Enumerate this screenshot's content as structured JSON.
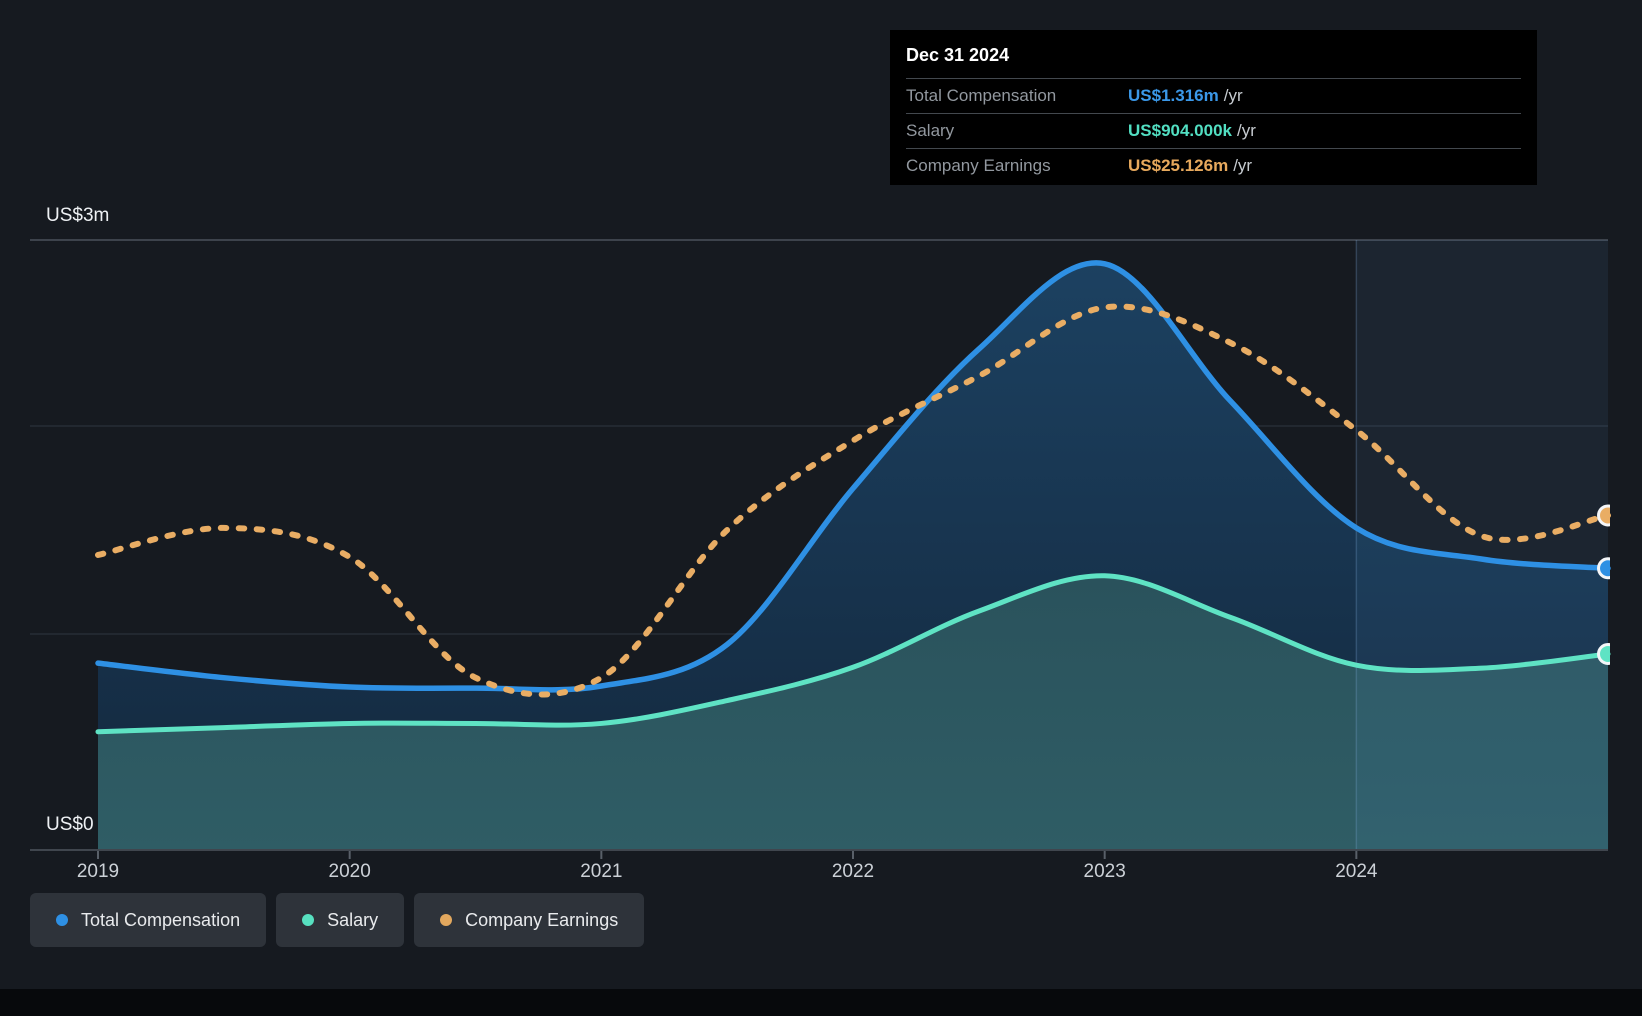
{
  "tooltip": {
    "title": "Dec 31 2024",
    "rows": [
      {
        "label": "Total Compensation",
        "value": "US$1.316m",
        "suffix": "/yr",
        "color": "#3b98e8"
      },
      {
        "label": "Salary",
        "value": "US$904.000k",
        "suffix": "/yr",
        "color": "#52dfc2"
      },
      {
        "label": "Company Earnings",
        "value": "US$25.126m",
        "suffix": "/yr",
        "color": "#e7a95d"
      }
    ]
  },
  "y_axis": {
    "top_label": "US$3m",
    "bottom_label": "US$0"
  },
  "x_axis": {
    "years": [
      "2019",
      "2020",
      "2021",
      "2022",
      "2023",
      "2024"
    ]
  },
  "legend": [
    {
      "label": "Total Compensation",
      "color": "#2e90e4"
    },
    {
      "label": "Salary",
      "color": "#57e0c0"
    },
    {
      "label": "Company Earnings",
      "color": "#e2a85e"
    }
  ],
  "chart_data": {
    "type": "area",
    "title": "CEO compensation over time",
    "x": [
      2019,
      2019.5,
      2020,
      2020.5,
      2021,
      2021.5,
      2022,
      2022.5,
      2023,
      2023.5,
      2024,
      2024.5,
      2025
    ],
    "x_tick_years": [
      2019,
      2020,
      2021,
      2022,
      2023,
      2024
    ],
    "ylim": [
      0,
      3
    ],
    "y_unit": "US$m",
    "grid_values": [
      3,
      2,
      1
    ],
    "highlight_range": [
      2024,
      2025
    ],
    "series": [
      {
        "name": "Total Compensation",
        "type": "line-area",
        "style": "solid",
        "color": "#2e90e4",
        "values": [
          0.86,
          0.79,
          0.745,
          0.74,
          0.75,
          0.95,
          1.7,
          2.37,
          2.78,
          2.12,
          1.51,
          1.36,
          1.316
        ],
        "latest": "US$1.316m /yr"
      },
      {
        "name": "Salary",
        "type": "line-area",
        "style": "solid",
        "color": "#5fe3c4",
        "values": [
          0.53,
          0.55,
          0.57,
          0.57,
          0.57,
          0.68,
          0.84,
          1.11,
          1.28,
          1.08,
          0.85,
          0.836,
          0.904
        ],
        "latest": "US$904.000k /yr"
      },
      {
        "name": "Company Earnings",
        "type": "dotted-line",
        "style": "dotted",
        "color": "#e9ad64",
        "values": [
          1.38,
          1.51,
          1.37,
          0.79,
          0.79,
          1.5,
          1.93,
          2.24,
          2.57,
          2.4,
          1.98,
          1.47,
          1.57
        ],
        "latest": "US$25.126m /yr",
        "note": "plotted on a hidden earnings scale; values here are left-axis display equivalents"
      }
    ],
    "legend_position": "bottom-left",
    "grid": true
  },
  "colors": {
    "background": "#161a20",
    "tooltip_bg": "#000000",
    "grid_top": "#3d434c",
    "grid_minor": "#272d36",
    "axis_line": "#40464e",
    "blue_fill_top": "#1c4161",
    "blue_fill_bottom": "#13273c",
    "teal_fill_top": "#2a525c",
    "teal_fill_bottom": "#2f5d65",
    "highlight_band": "rgba(90,150,210,0.09)",
    "highlight_edge": "rgba(130,175,225,0.25)",
    "dot_ring": "#f4f6f8"
  }
}
